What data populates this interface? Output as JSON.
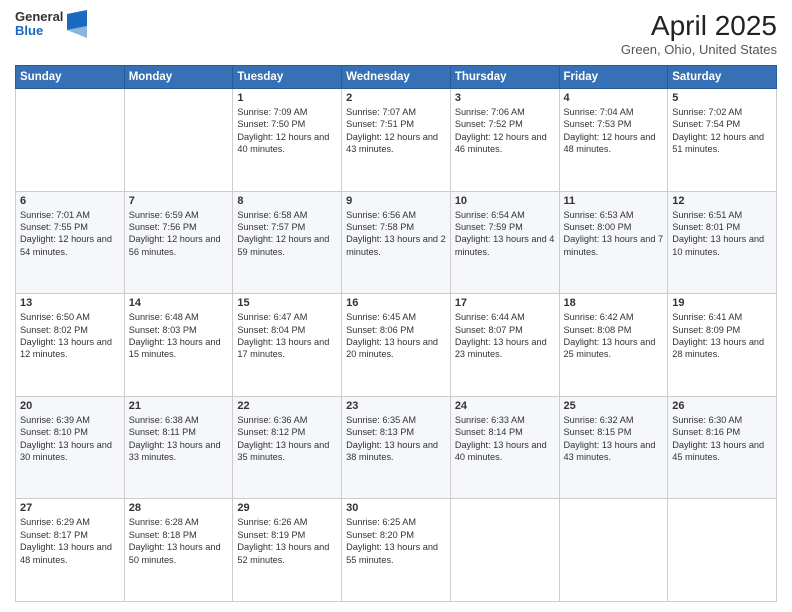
{
  "logo": {
    "general": "General",
    "blue": "Blue"
  },
  "title": {
    "main": "April 2025",
    "sub": "Green, Ohio, United States"
  },
  "days_of_week": [
    "Sunday",
    "Monday",
    "Tuesday",
    "Wednesday",
    "Thursday",
    "Friday",
    "Saturday"
  ],
  "weeks": [
    [
      {
        "day": "",
        "info": ""
      },
      {
        "day": "",
        "info": ""
      },
      {
        "day": "1",
        "info": "Sunrise: 7:09 AM\nSunset: 7:50 PM\nDaylight: 12 hours and 40 minutes."
      },
      {
        "day": "2",
        "info": "Sunrise: 7:07 AM\nSunset: 7:51 PM\nDaylight: 12 hours and 43 minutes."
      },
      {
        "day": "3",
        "info": "Sunrise: 7:06 AM\nSunset: 7:52 PM\nDaylight: 12 hours and 46 minutes."
      },
      {
        "day": "4",
        "info": "Sunrise: 7:04 AM\nSunset: 7:53 PM\nDaylight: 12 hours and 48 minutes."
      },
      {
        "day": "5",
        "info": "Sunrise: 7:02 AM\nSunset: 7:54 PM\nDaylight: 12 hours and 51 minutes."
      }
    ],
    [
      {
        "day": "6",
        "info": "Sunrise: 7:01 AM\nSunset: 7:55 PM\nDaylight: 12 hours and 54 minutes."
      },
      {
        "day": "7",
        "info": "Sunrise: 6:59 AM\nSunset: 7:56 PM\nDaylight: 12 hours and 56 minutes."
      },
      {
        "day": "8",
        "info": "Sunrise: 6:58 AM\nSunset: 7:57 PM\nDaylight: 12 hours and 59 minutes."
      },
      {
        "day": "9",
        "info": "Sunrise: 6:56 AM\nSunset: 7:58 PM\nDaylight: 13 hours and 2 minutes."
      },
      {
        "day": "10",
        "info": "Sunrise: 6:54 AM\nSunset: 7:59 PM\nDaylight: 13 hours and 4 minutes."
      },
      {
        "day": "11",
        "info": "Sunrise: 6:53 AM\nSunset: 8:00 PM\nDaylight: 13 hours and 7 minutes."
      },
      {
        "day": "12",
        "info": "Sunrise: 6:51 AM\nSunset: 8:01 PM\nDaylight: 13 hours and 10 minutes."
      }
    ],
    [
      {
        "day": "13",
        "info": "Sunrise: 6:50 AM\nSunset: 8:02 PM\nDaylight: 13 hours and 12 minutes."
      },
      {
        "day": "14",
        "info": "Sunrise: 6:48 AM\nSunset: 8:03 PM\nDaylight: 13 hours and 15 minutes."
      },
      {
        "day": "15",
        "info": "Sunrise: 6:47 AM\nSunset: 8:04 PM\nDaylight: 13 hours and 17 minutes."
      },
      {
        "day": "16",
        "info": "Sunrise: 6:45 AM\nSunset: 8:06 PM\nDaylight: 13 hours and 20 minutes."
      },
      {
        "day": "17",
        "info": "Sunrise: 6:44 AM\nSunset: 8:07 PM\nDaylight: 13 hours and 23 minutes."
      },
      {
        "day": "18",
        "info": "Sunrise: 6:42 AM\nSunset: 8:08 PM\nDaylight: 13 hours and 25 minutes."
      },
      {
        "day": "19",
        "info": "Sunrise: 6:41 AM\nSunset: 8:09 PM\nDaylight: 13 hours and 28 minutes."
      }
    ],
    [
      {
        "day": "20",
        "info": "Sunrise: 6:39 AM\nSunset: 8:10 PM\nDaylight: 13 hours and 30 minutes."
      },
      {
        "day": "21",
        "info": "Sunrise: 6:38 AM\nSunset: 8:11 PM\nDaylight: 13 hours and 33 minutes."
      },
      {
        "day": "22",
        "info": "Sunrise: 6:36 AM\nSunset: 8:12 PM\nDaylight: 13 hours and 35 minutes."
      },
      {
        "day": "23",
        "info": "Sunrise: 6:35 AM\nSunset: 8:13 PM\nDaylight: 13 hours and 38 minutes."
      },
      {
        "day": "24",
        "info": "Sunrise: 6:33 AM\nSunset: 8:14 PM\nDaylight: 13 hours and 40 minutes."
      },
      {
        "day": "25",
        "info": "Sunrise: 6:32 AM\nSunset: 8:15 PM\nDaylight: 13 hours and 43 minutes."
      },
      {
        "day": "26",
        "info": "Sunrise: 6:30 AM\nSunset: 8:16 PM\nDaylight: 13 hours and 45 minutes."
      }
    ],
    [
      {
        "day": "27",
        "info": "Sunrise: 6:29 AM\nSunset: 8:17 PM\nDaylight: 13 hours and 48 minutes."
      },
      {
        "day": "28",
        "info": "Sunrise: 6:28 AM\nSunset: 8:18 PM\nDaylight: 13 hours and 50 minutes."
      },
      {
        "day": "29",
        "info": "Sunrise: 6:26 AM\nSunset: 8:19 PM\nDaylight: 13 hours and 52 minutes."
      },
      {
        "day": "30",
        "info": "Sunrise: 6:25 AM\nSunset: 8:20 PM\nDaylight: 13 hours and 55 minutes."
      },
      {
        "day": "",
        "info": ""
      },
      {
        "day": "",
        "info": ""
      },
      {
        "day": "",
        "info": ""
      }
    ]
  ]
}
